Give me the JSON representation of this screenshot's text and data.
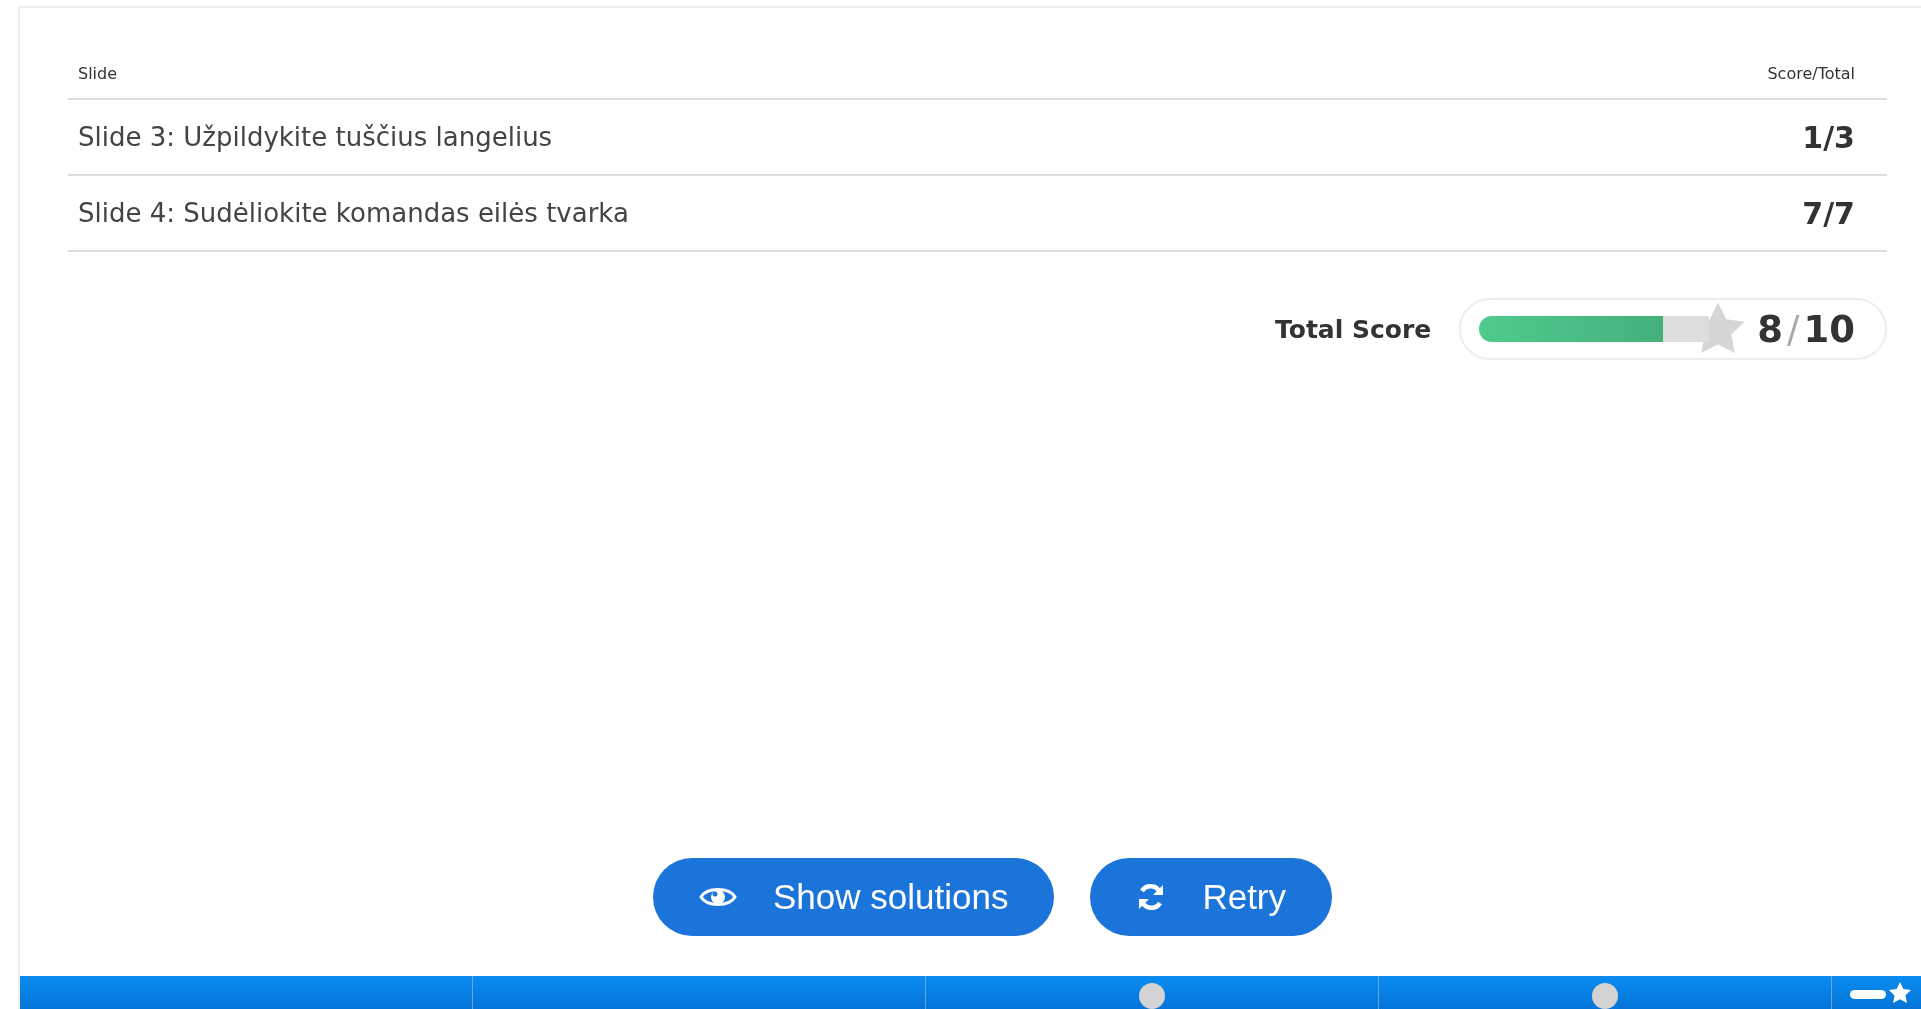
{
  "table": {
    "columns": [
      "Slide",
      "Score/Total"
    ],
    "rows": [
      {
        "slide": "Slide 3: Užpildykite tuščius langelius",
        "score": "1/3"
      },
      {
        "slide": "Slide 4: Sudėliokite komandas eilės tvarka",
        "score": "7/7"
      }
    ]
  },
  "total": {
    "label": "Total Score",
    "level": 0.8,
    "score": "8",
    "separator": "/",
    "max": "10"
  },
  "buttons": [
    {
      "kind": "solutions",
      "label": "Show solutions"
    },
    {
      "kind": "retry",
      "label": "Retry"
    }
  ],
  "navigation": [
    {
      "kind": "plain"
    },
    {
      "kind": "plain"
    },
    {
      "kind": "task"
    },
    {
      "kind": "task"
    },
    {
      "kind": "summary"
    }
  ]
}
